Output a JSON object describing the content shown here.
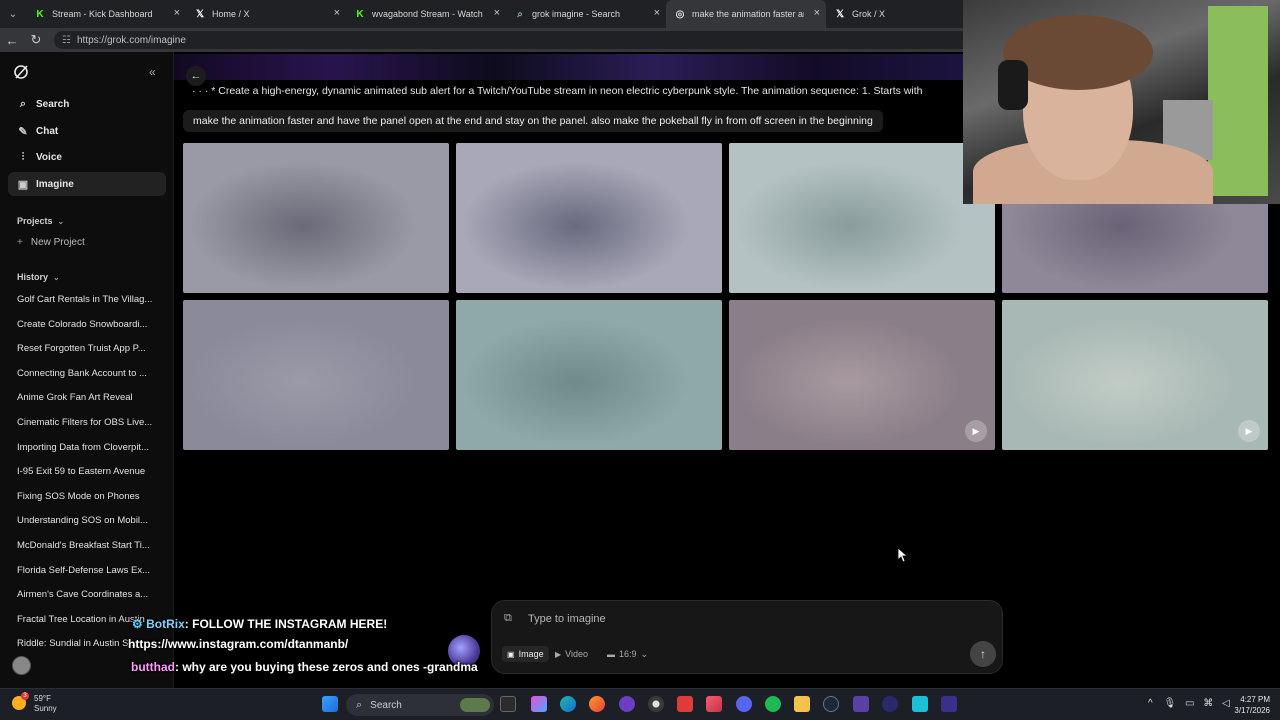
{
  "browser": {
    "tabs": [
      {
        "title": "Stream - Kick Dashboard",
        "favicon": "kick-icon"
      },
      {
        "title": "Home / X",
        "favicon": "x-icon"
      },
      {
        "title": "wvagabond Stream - Watch Live o",
        "favicon": "kick-icon"
      },
      {
        "title": "grok imagine - Search",
        "favicon": "search-icon"
      },
      {
        "title": "make the animation faster and ha",
        "favicon": "grok-icon",
        "active": true
      },
      {
        "title": "Grok / X",
        "favicon": "x-icon"
      }
    ],
    "url": "https://grok.com/imagine"
  },
  "sidebar": {
    "nav": [
      {
        "label": "Search",
        "icon": "search-icon"
      },
      {
        "label": "Chat",
        "icon": "chat-icon"
      },
      {
        "label": "Voice",
        "icon": "voice-icon"
      },
      {
        "label": "Imagine",
        "icon": "image-icon",
        "active": true
      }
    ],
    "projects_label": "Projects",
    "new_project_label": "New Project",
    "history_label": "History",
    "history": [
      "Golf Cart Rentals in The Villag...",
      "Create Colorado Snowboardi...",
      "Reset Forgotten Truist App P...",
      "Connecting Bank Account to ...",
      "Anime Grok Fan Art Reveal",
      "Cinematic Filters for OBS Live...",
      "Importing Data from Cloverpit...",
      "I-95 Exit 59 to Eastern Avenue",
      "Fixing SOS Mode on Phones",
      "Understanding SOS on Mobil...",
      "McDonald's Breakfast Start Ti...",
      "Florida Self-Defense Laws Ex...",
      "Airmen's Cave Coordinates a...",
      "Fractal Tree Location in Austin",
      "Riddle: Sundial in Austin S..."
    ]
  },
  "main": {
    "prompt_preview": "* Create a high-energy, dynamic animated sub alert for a Twitch/YouTube stream in neon electric cyberpunk style. The animation sequence: 1. Starts with",
    "prompt_current": "make the animation faster and have the panel open at the end and stay on the panel. also make the pokeball fly in from off screen in the beginning",
    "thumbnails": [
      {
        "colors": [
          "#9a9aa6",
          "#6a6a78"
        ],
        "video": false
      },
      {
        "colors": [
          "#a8a8b8",
          "#6a6a80"
        ],
        "video": false
      },
      {
        "colors": [
          "#b4c2c4",
          "#8a9c9c"
        ],
        "video": false
      },
      {
        "colors": [
          "#8e8898",
          "#6a6276"
        ],
        "video": false
      },
      {
        "colors": [
          "#8a8a9a",
          "#9a9aa8"
        ],
        "video": false
      },
      {
        "colors": [
          "#8fa8a8",
          "#6f8a8a"
        ],
        "video": false
      },
      {
        "colors": [
          "#8a7e88",
          "#a89aa0"
        ],
        "video": true
      },
      {
        "colors": [
          "#a8b8b4",
          "#c2ccc6"
        ],
        "video": true
      }
    ]
  },
  "composer": {
    "placeholder": "Type to imagine",
    "modes": [
      {
        "label": "Image",
        "icon": "image-icon",
        "selected": true
      },
      {
        "label": "Video",
        "icon": "video-icon",
        "selected": false
      }
    ],
    "aspect": "16:9"
  },
  "chat_overlay": {
    "line1_user": "BotRix",
    "line1_text": ": FOLLOW THE INSTAGRAM HERE!",
    "line2_text": "https://www.instagram.com/dtanmanb/",
    "line3_user": "butthad",
    "line3_text": ": why are you buying these zeros and ones -grandma"
  },
  "taskbar": {
    "weather_temp": "59°F",
    "weather_desc": "Sunny",
    "weather_badge": "3",
    "search_label": "Search",
    "time": "4:27 PM",
    "date": "3/17/2026"
  }
}
